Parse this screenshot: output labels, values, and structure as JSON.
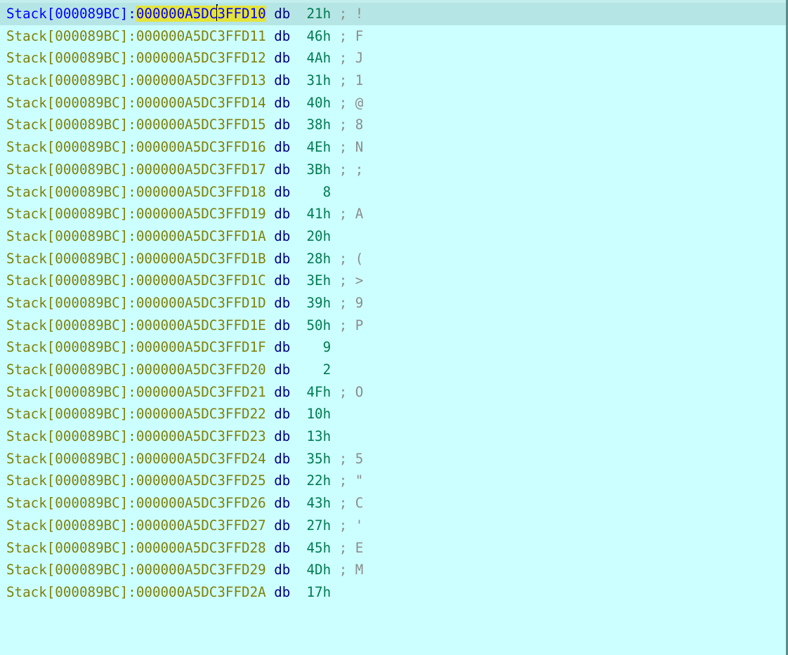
{
  "disassembly": {
    "lines": [
      {
        "seg": "Stack[000089BC]",
        "addr": "000000A5DC3FFD10",
        "mnem": "db",
        "val": "21h",
        "cmt": "; !",
        "current": true
      },
      {
        "seg": "Stack[000089BC]",
        "addr": "000000A5DC3FFD11",
        "mnem": "db",
        "val": "46h",
        "cmt": "; F"
      },
      {
        "seg": "Stack[000089BC]",
        "addr": "000000A5DC3FFD12",
        "mnem": "db",
        "val": "4Ah",
        "cmt": "; J"
      },
      {
        "seg": "Stack[000089BC]",
        "addr": "000000A5DC3FFD13",
        "mnem": "db",
        "val": "31h",
        "cmt": "; 1"
      },
      {
        "seg": "Stack[000089BC]",
        "addr": "000000A5DC3FFD14",
        "mnem": "db",
        "val": "40h",
        "cmt": "; @"
      },
      {
        "seg": "Stack[000089BC]",
        "addr": "000000A5DC3FFD15",
        "mnem": "db",
        "val": "38h",
        "cmt": "; 8"
      },
      {
        "seg": "Stack[000089BC]",
        "addr": "000000A5DC3FFD16",
        "mnem": "db",
        "val": "4Eh",
        "cmt": "; N"
      },
      {
        "seg": "Stack[000089BC]",
        "addr": "000000A5DC3FFD17",
        "mnem": "db",
        "val": "3Bh",
        "cmt": "; ;"
      },
      {
        "seg": "Stack[000089BC]",
        "addr": "000000A5DC3FFD18",
        "mnem": "db",
        "val": "  8",
        "cmt": ""
      },
      {
        "seg": "Stack[000089BC]",
        "addr": "000000A5DC3FFD19",
        "mnem": "db",
        "val": "41h",
        "cmt": "; A"
      },
      {
        "seg": "Stack[000089BC]",
        "addr": "000000A5DC3FFD1A",
        "mnem": "db",
        "val": "20h",
        "cmt": ""
      },
      {
        "seg": "Stack[000089BC]",
        "addr": "000000A5DC3FFD1B",
        "mnem": "db",
        "val": "28h",
        "cmt": "; ("
      },
      {
        "seg": "Stack[000089BC]",
        "addr": "000000A5DC3FFD1C",
        "mnem": "db",
        "val": "3Eh",
        "cmt": "; >"
      },
      {
        "seg": "Stack[000089BC]",
        "addr": "000000A5DC3FFD1D",
        "mnem": "db",
        "val": "39h",
        "cmt": "; 9"
      },
      {
        "seg": "Stack[000089BC]",
        "addr": "000000A5DC3FFD1E",
        "mnem": "db",
        "val": "50h",
        "cmt": "; P"
      },
      {
        "seg": "Stack[000089BC]",
        "addr": "000000A5DC3FFD1F",
        "mnem": "db",
        "val": "  9",
        "cmt": ""
      },
      {
        "seg": "Stack[000089BC]",
        "addr": "000000A5DC3FFD20",
        "mnem": "db",
        "val": "  2",
        "cmt": ""
      },
      {
        "seg": "Stack[000089BC]",
        "addr": "000000A5DC3FFD21",
        "mnem": "db",
        "val": "4Fh",
        "cmt": "; O"
      },
      {
        "seg": "Stack[000089BC]",
        "addr": "000000A5DC3FFD22",
        "mnem": "db",
        "val": "10h",
        "cmt": ""
      },
      {
        "seg": "Stack[000089BC]",
        "addr": "000000A5DC3FFD23",
        "mnem": "db",
        "val": "13h",
        "cmt": ""
      },
      {
        "seg": "Stack[000089BC]",
        "addr": "000000A5DC3FFD24",
        "mnem": "db",
        "val": "35h",
        "cmt": "; 5"
      },
      {
        "seg": "Stack[000089BC]",
        "addr": "000000A5DC3FFD25",
        "mnem": "db",
        "val": "22h",
        "cmt": "; \""
      },
      {
        "seg": "Stack[000089BC]",
        "addr": "000000A5DC3FFD26",
        "mnem": "db",
        "val": "43h",
        "cmt": "; C"
      },
      {
        "seg": "Stack[000089BC]",
        "addr": "000000A5DC3FFD27",
        "mnem": "db",
        "val": "27h",
        "cmt": "; '"
      },
      {
        "seg": "Stack[000089BC]",
        "addr": "000000A5DC3FFD28",
        "mnem": "db",
        "val": "45h",
        "cmt": "; E"
      },
      {
        "seg": "Stack[000089BC]",
        "addr": "000000A5DC3FFD29",
        "mnem": "db",
        "val": "4Dh",
        "cmt": "; M"
      },
      {
        "seg": "Stack[000089BC]",
        "addr": "000000A5DC3FFD2A",
        "mnem": "db",
        "val": "17h",
        "cmt": ""
      }
    ]
  },
  "colors": {
    "background": "#ccffff",
    "current_line": "#b6e5e5",
    "segment_address": "#80800a",
    "highlight": "#e4e43a",
    "current_segment": "#0000ff",
    "mnemonic": "#000080",
    "value": "#007a50",
    "comment": "#8c8c8c"
  }
}
